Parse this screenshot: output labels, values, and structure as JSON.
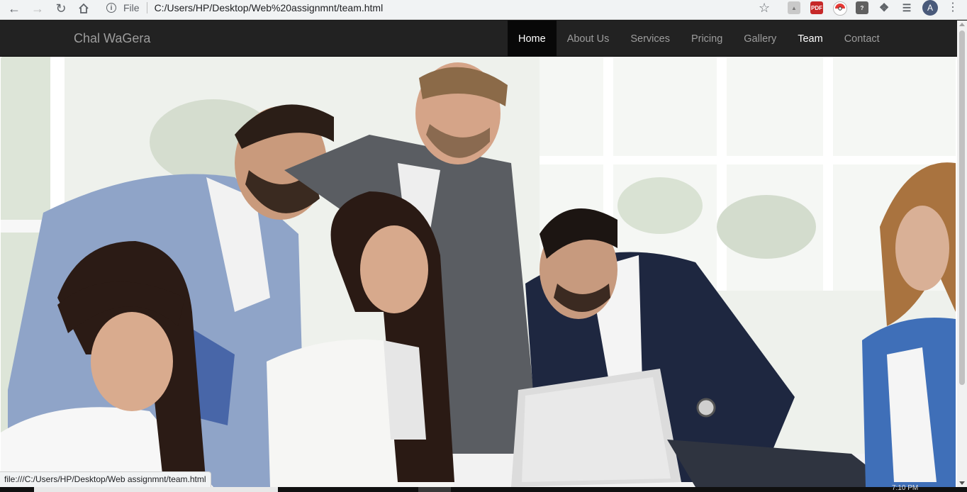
{
  "browser": {
    "back_icon": "arrow-left-icon",
    "forward_icon": "arrow-right-icon",
    "reload_icon": "reload-icon",
    "home_icon": "home-icon",
    "scheme_label": "File",
    "url": "C:/Users/HP/Desktop/Web%20assignmnt/team.html",
    "profile_initial": "A",
    "extensions": [
      "acrobat-icon",
      "pdf-icon",
      "pokeball-icon",
      "help-icon",
      "puzzle-icon",
      "media-icon"
    ],
    "ext_labels": {
      "pdf": "PDF",
      "help": "?"
    }
  },
  "navbar": {
    "brand": "Chal WaGera",
    "items": [
      {
        "label": "Home",
        "state": "active"
      },
      {
        "label": "About Us",
        "state": ""
      },
      {
        "label": "Services",
        "state": ""
      },
      {
        "label": "Pricing",
        "state": ""
      },
      {
        "label": "Gallery",
        "state": ""
      },
      {
        "label": "Team",
        "state": "current"
      },
      {
        "label": "Contact",
        "state": ""
      }
    ]
  },
  "hero": {
    "image": "team-photo-business-people-with-laptop"
  },
  "status_bar": {
    "link_preview": "file:///C:/Users/HP/Desktop/Web assignmnt/team.html"
  },
  "taskbar": {
    "clock": "7:10 PM"
  },
  "colors": {
    "navbar_bg": "#222222",
    "nav_active_bg": "#080808",
    "nav_text": "#9d9d9d",
    "nav_text_active": "#ffffff"
  }
}
